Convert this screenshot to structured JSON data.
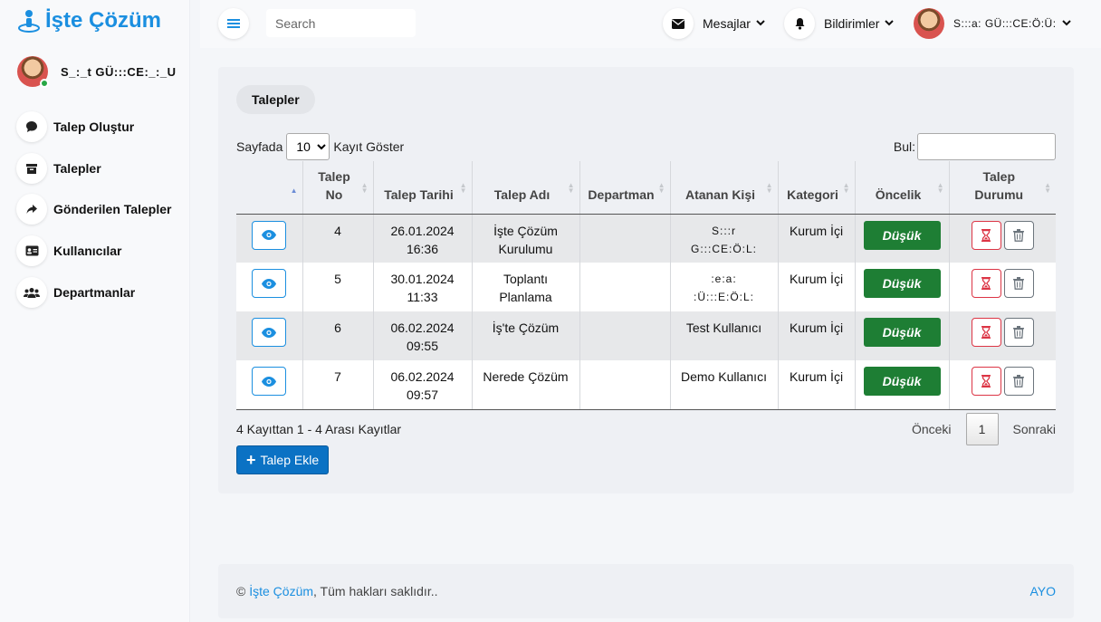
{
  "brand": {
    "name": "İşte Çözüm"
  },
  "user": {
    "name": "S_:_t GÜ:::CE:_:_U"
  },
  "sidebar": {
    "items": [
      {
        "label": "Talep Oluştur",
        "icon": "comment-icon"
      },
      {
        "label": "Talepler",
        "icon": "archive-icon"
      },
      {
        "label": "Gönderilen Talepler",
        "icon": "share-icon"
      },
      {
        "label": "Kullanıcılar",
        "icon": "id-card-icon"
      },
      {
        "label": "Departmanlar",
        "icon": "users-icon"
      }
    ]
  },
  "topbar": {
    "search_placeholder": "Search",
    "messages_label": "Mesajlar",
    "notifications_label": "Bildirimler",
    "user_label": "S:::a: GÜ:::CE:Ö:Ü:"
  },
  "page": {
    "title": "Talepler",
    "length_prefix": "Sayfada",
    "length_value": "10",
    "length_suffix": "Kayıt Göster",
    "filter_label": "Bul:",
    "info": "4 Kayıttan 1 - 4 Arası Kayıtlar",
    "prev": "Önceki",
    "current_page": "1",
    "next": "Sonraki",
    "add_button": "Talep Ekle"
  },
  "table": {
    "columns": [
      "",
      "Talep\nNo",
      "Talep Tarihi",
      "Talep Adı",
      "Departman",
      "Atanan Kişi",
      "Kategori",
      "Öncelik",
      "Talep\nDurumu"
    ],
    "rows": [
      {
        "no": "4",
        "date": "26.01.2024\n16:36",
        "name": "İşte Çözüm\nKurulumu",
        "department": "",
        "assignee": "S:::r\nG:::CE:Ö:L:",
        "category": "Kurum İçi",
        "priority": "Düşük"
      },
      {
        "no": "5",
        "date": "30.01.2024\n11:33",
        "name": "Toplantı\nPlanlama",
        "department": "",
        "assignee": ":e:a:\n:Ü:::E:Ö:L:",
        "category": "Kurum İçi",
        "priority": "Düşük"
      },
      {
        "no": "6",
        "date": "06.02.2024\n09:55",
        "name": "İş'te Çözüm",
        "department": "",
        "assignee": "Test Kullanıcı",
        "category": "Kurum İçi",
        "priority": "Düşük"
      },
      {
        "no": "7",
        "date": "06.02.2024\n09:57",
        "name": "Nerede Çözüm",
        "department": "",
        "assignee": "Demo Kullanıcı",
        "category": "Kurum İçi",
        "priority": "Düşük"
      }
    ]
  },
  "footer": {
    "copyright_symbol": "©",
    "brand_link": "İşte Çözüm",
    "rights": ", Tüm hakları saklıdır..",
    "right_text": "AYO"
  },
  "colors": {
    "accent": "#1b8fe0",
    "priority": "#1e7e34",
    "danger": "#dc3545",
    "primary_button": "#0b72c4"
  }
}
